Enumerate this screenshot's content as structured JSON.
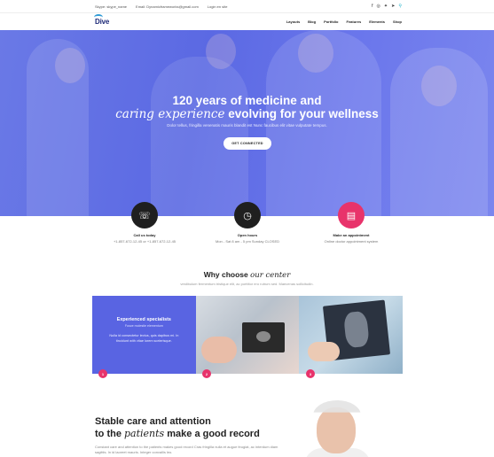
{
  "topbar": {
    "skype": "Skype: skype_name",
    "email": "Email: Dynamicframeworks@gmail.com",
    "login": "Login en site",
    "socials": [
      "facebook-icon",
      "instagram-icon",
      "twitter-icon",
      "telegram-icon",
      "location-icon"
    ]
  },
  "nav": {
    "logo": "Dive",
    "links": [
      "Layouts",
      "Blog",
      "Portfolio",
      "Features",
      "Elements",
      "Shop"
    ]
  },
  "hero": {
    "title_line1": "120 years of medicine and",
    "title_italic": "caring experience",
    "title_rest": " evolving for your wellness",
    "subtitle": "Dolor tellus, fringilla venenatis mauris blandit est Nunc faucibus elit vitae vulputate tempus.",
    "button": "GET CONNECTED"
  },
  "info": [
    {
      "icon": "phone-icon",
      "title": "Call us today",
      "detail": "+1-857-672-12-45 or +1-857-672-12-45",
      "color": "#1f1f1f"
    },
    {
      "icon": "clock-icon",
      "title": "Open hours",
      "detail": "Mon - Sat 8 am - 5 pm Sunday CLOSED",
      "color": "#1f1f1f"
    },
    {
      "icon": "appointment-icon",
      "title": "Make an appointment",
      "detail": "Online doctor appointment system",
      "color": "#e8336b"
    }
  ],
  "why": {
    "title_plain": "Why choose ",
    "title_italic": "our center",
    "subtitle": "vestibulum fermentum tristique elit, ac porttitor ero rutrum sed. Maecenas sollicitudin."
  },
  "cards": [
    {
      "title": "Experienced specialists",
      "subtitle": "Fusce molestie elementum",
      "desc": "Nulla id consectetur lectus, quis dapibus mi. In tincidunt with vitae lorem scelerisque.",
      "num": "1"
    },
    {
      "num": "2"
    },
    {
      "num": "3"
    }
  ],
  "stable": {
    "line1": "Stable care and attention",
    "line2_pre": "to the ",
    "line2_italic": "patients",
    "line2_post": " make a good record",
    "desc": "Constant care and attention to the patients makes good record Cras fringilla nulla et augue feugiat, ac interdum diam sagittis. In id laoreet mauris. Integer convallis leo."
  },
  "colors": {
    "hero": "#5b69e3",
    "accent": "#e8336b",
    "card": "#5964e2"
  }
}
